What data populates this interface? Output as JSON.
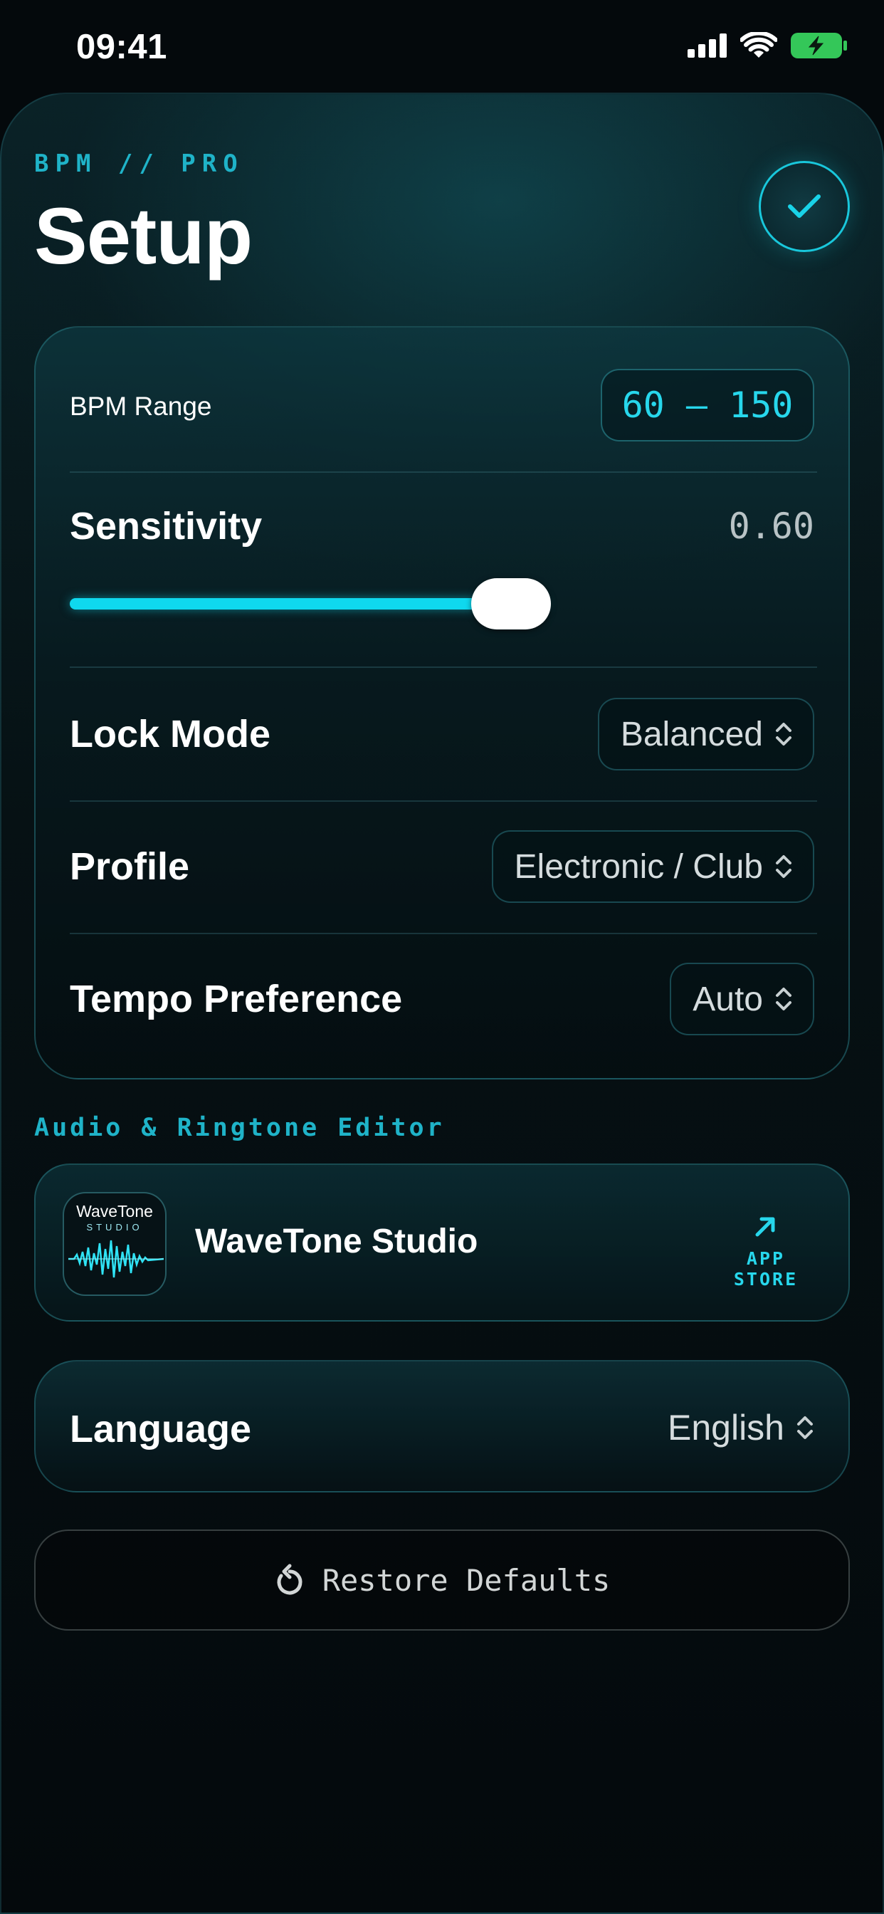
{
  "status_bar": {
    "time": "09:41"
  },
  "header": {
    "brand": "BPM // PRO",
    "title": "Setup",
    "done_icon": "checkmark-icon"
  },
  "settings": {
    "bpm_range": {
      "label": "BPM Range",
      "value": "60 – 150"
    },
    "sensitivity": {
      "label": "Sensitivity",
      "value": "0.60",
      "slider_level": 0.6
    },
    "lock_mode": {
      "label": "Lock Mode",
      "value": "Balanced"
    },
    "profile": {
      "label": "Profile",
      "value": "Electronic / Club"
    },
    "tempo_preference": {
      "label": "Tempo Preference",
      "value": "Auto"
    }
  },
  "promo": {
    "section_title": "Audio & Ringtone Editor",
    "app_name": "WaveTone Studio",
    "icon_title": "WaveTone",
    "icon_subtitle": "STUDIO",
    "store_label": "APP STORE"
  },
  "language": {
    "label": "Language",
    "value": "English"
  },
  "restore": {
    "label": "Restore Defaults"
  },
  "colors": {
    "accent": "#1fd3e8",
    "background": "#04090c",
    "battery": "#34c759"
  }
}
